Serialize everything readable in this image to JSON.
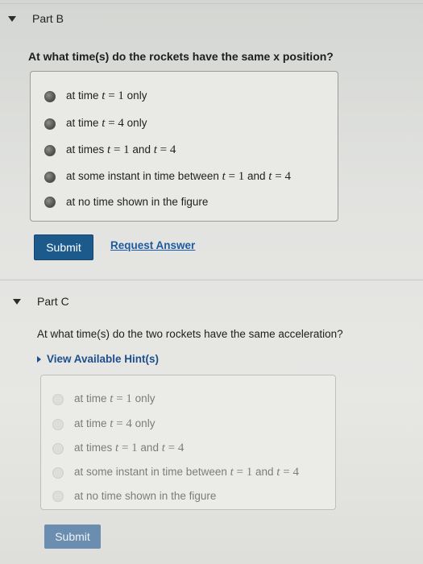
{
  "part_b": {
    "title": "Part B",
    "question": "At what time(s) do the rockets have the same x position?",
    "options": [
      {
        "pre": "at time",
        "var1": "t",
        "eq1": " = ",
        "val1": "1",
        "suf": " only"
      },
      {
        "pre": "at time",
        "var1": "t",
        "eq1": " = ",
        "val1": "4",
        "suf": " only"
      },
      {
        "pre": "at times",
        "var1": "t",
        "eq1": " = ",
        "val1": "1",
        "mid": " and ",
        "var2": "t",
        "eq2": " = ",
        "val2": "4"
      },
      {
        "pre": "at some instant in time between",
        "var1": "t",
        "eq1": " = ",
        "val1": "1",
        "mid": " and ",
        "var2": "t",
        "eq2": " = ",
        "val2": "4"
      },
      {
        "pre": "at no time shown in the figure"
      }
    ],
    "submit_label": "Submit",
    "request_label": "Request Answer"
  },
  "part_c": {
    "title": "Part C",
    "question": "At what time(s) do the two rockets have the same acceleration?",
    "hint_label": "View Available Hint(s)",
    "options": [
      {
        "pre": "at time",
        "var1": "t",
        "eq1": " = ",
        "val1": "1",
        "suf": " only"
      },
      {
        "pre": "at time",
        "var1": "t",
        "eq1": " = ",
        "val1": "4",
        "suf": " only"
      },
      {
        "pre": "at times",
        "var1": "t",
        "eq1": " = ",
        "val1": "1",
        "mid": " and ",
        "var2": "t",
        "eq2": " = ",
        "val2": "4"
      },
      {
        "pre": "at some instant in time between",
        "var1": "t",
        "eq1": " = ",
        "val1": "1",
        "mid": " and ",
        "var2": "t",
        "eq2": " = ",
        "val2": "4"
      },
      {
        "pre": "at no time shown in the figure"
      }
    ],
    "submit_label": "Submit"
  }
}
